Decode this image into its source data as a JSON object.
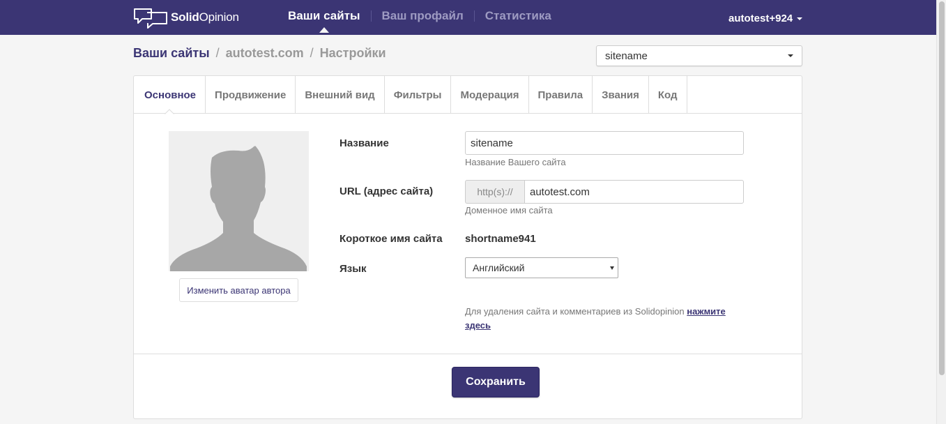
{
  "brand": {
    "name_bold": "Solid",
    "name_light": "Opinion",
    "color": "#3b3574"
  },
  "nav": {
    "items": [
      {
        "label": "Ваши сайты",
        "active": true
      },
      {
        "label": "Ваш профайл",
        "active": false
      },
      {
        "label": "Статистика",
        "active": false
      }
    ],
    "user": "autotest+924"
  },
  "breadcrumb": {
    "root": "Ваши сайты",
    "site": "autotest.com",
    "page": "Настройки",
    "separator": "/"
  },
  "site_select": {
    "value": "sitename"
  },
  "tabs": [
    {
      "label": "Основное",
      "active": true
    },
    {
      "label": "Продвижение"
    },
    {
      "label": "Внешний вид"
    },
    {
      "label": "Фильтры"
    },
    {
      "label": "Модерация"
    },
    {
      "label": "Правила"
    },
    {
      "label": "Звания"
    },
    {
      "label": "Код"
    }
  ],
  "avatar": {
    "change_label": "Изменить аватар автора"
  },
  "form": {
    "name": {
      "label": "Название",
      "value": "sitename",
      "help": "Название Вашего сайта"
    },
    "url": {
      "label": "URL (адрес сайта)",
      "prefix": "http(s)://",
      "value": "autotest.com",
      "help": "Доменное имя сайта"
    },
    "shortname": {
      "label": "Короткое имя сайта",
      "value": "shortname941"
    },
    "language": {
      "label": "Язык",
      "value": "Английский"
    },
    "delete_note": {
      "text": "Для удаления сайта и комментариев из Solidopinion ",
      "link": "нажмите здесь"
    }
  },
  "save_label": "Сохранить"
}
